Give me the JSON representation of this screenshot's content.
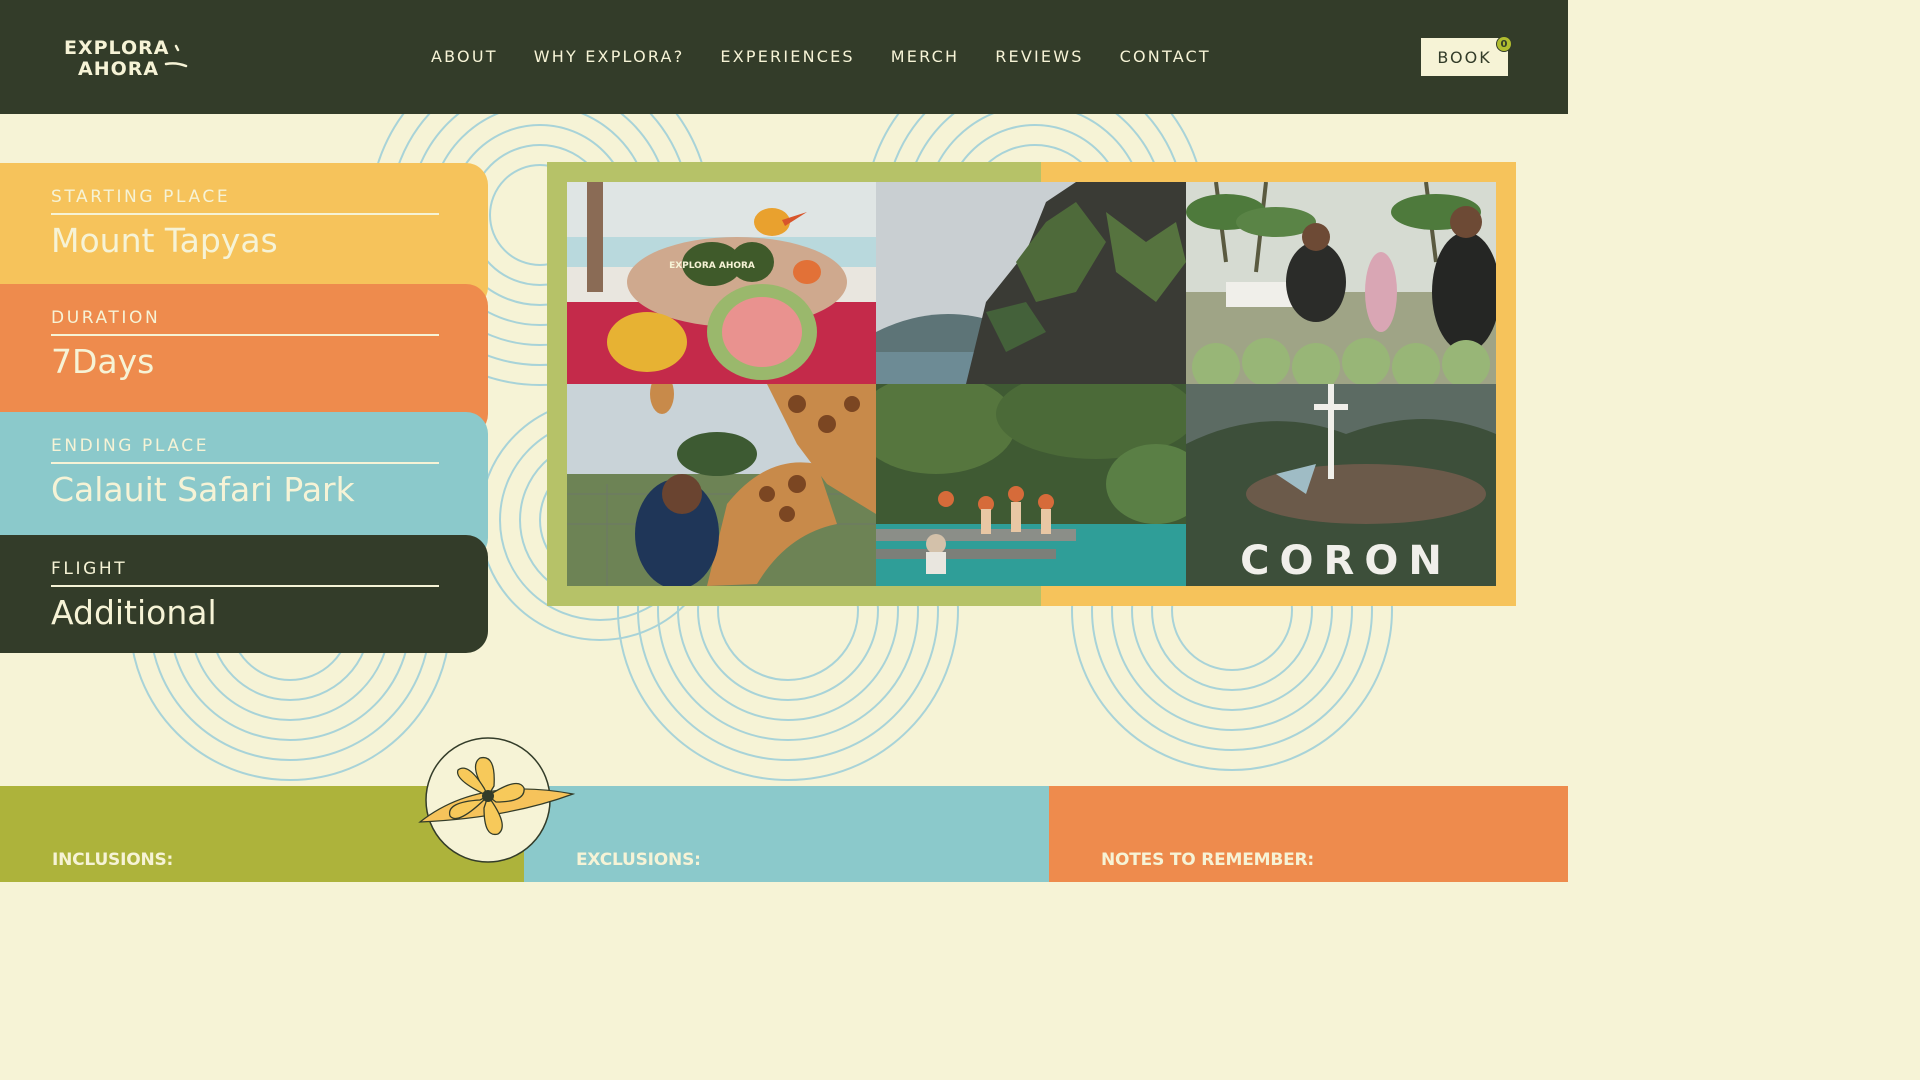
{
  "header": {
    "logo": {
      "line1": "EXPLORA",
      "line2": "AHORA"
    },
    "nav": [
      "ABOUT",
      "WHY EXPLORA?",
      "EXPERIENCES",
      "MERCH",
      "REVIEWS",
      "CONTACT"
    ],
    "book_label": "BOOK",
    "cart_count": "0"
  },
  "info_cards": [
    {
      "label": "STARTING PLACE",
      "value": "Mount Tapyas",
      "color": "#f6c35b"
    },
    {
      "label": "DURATION",
      "value": "7Days",
      "color": "#ee8b4d"
    },
    {
      "label": "ENDING PLACE",
      "value": "Calauit Safari Park",
      "color": "#8bc9cb"
    },
    {
      "label": "FLIGHT",
      "value": "Additional",
      "color": "#333c29"
    }
  ],
  "gallery": {
    "photos": [
      {
        "subject": "carved fruit platter"
      },
      {
        "subject": "limestone cliff by sea"
      },
      {
        "subject": "coconut vendors"
      },
      {
        "subject": "boy with giraffe"
      },
      {
        "subject": "lagoon swimmers"
      },
      {
        "subject": "Coron hill sign"
      }
    ],
    "sign_text": "CORON",
    "platter_text": "EXPLORA AHORA"
  },
  "bottom": {
    "inclusions_title": "INCLUSIONS:",
    "exclusions_title": "EXCLUSIONS:",
    "notes_title": "NOTES TO REMEMBER:"
  },
  "colors": {
    "dark_green": "#333c29",
    "cream": "#f6f3d6",
    "yellow": "#f6c35b",
    "orange": "#ee8b4d",
    "teal": "#8bc9cb",
    "olive": "#adb33b"
  },
  "icons": [
    "flower-icon",
    "logo-swoosh-icon"
  ]
}
